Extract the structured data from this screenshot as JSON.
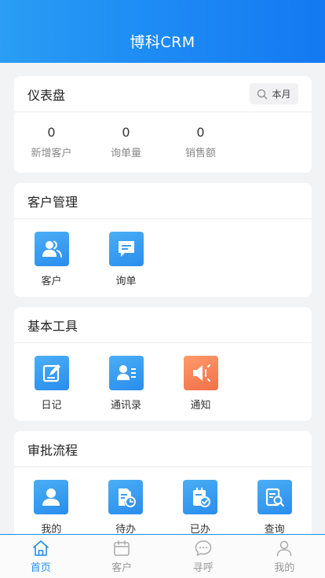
{
  "header": {
    "title": "博科CRM"
  },
  "dashboard": {
    "title": "仪表盘",
    "period_filter": "本月",
    "stats": [
      {
        "value": "0",
        "label": "新增客户"
      },
      {
        "value": "0",
        "label": "询单量"
      },
      {
        "value": "0",
        "label": "销售额"
      }
    ]
  },
  "customer_mgmt": {
    "title": "客户管理",
    "items": [
      {
        "label": "客户",
        "icon": "customers-icon"
      },
      {
        "label": "询单",
        "icon": "inquiry-icon"
      }
    ]
  },
  "basic_tools": {
    "title": "基本工具",
    "items": [
      {
        "label": "日记",
        "icon": "diary-icon"
      },
      {
        "label": "通讯录",
        "icon": "contacts-icon"
      },
      {
        "label": "通知",
        "icon": "notification-icon"
      }
    ]
  },
  "approval": {
    "title": "审批流程",
    "items": [
      {
        "label": "我的",
        "icon": "my-approval-icon"
      },
      {
        "label": "待办",
        "icon": "pending-icon"
      },
      {
        "label": "已办",
        "icon": "done-icon"
      },
      {
        "label": "查询",
        "icon": "query-icon"
      }
    ]
  },
  "tabbar": {
    "items": [
      {
        "label": "首页",
        "icon": "home-icon",
        "active": true
      },
      {
        "label": "客户",
        "icon": "calendar-icon",
        "active": false
      },
      {
        "label": "寻呼",
        "icon": "chat-icon",
        "active": false
      },
      {
        "label": "我的",
        "icon": "user-icon",
        "active": false
      }
    ]
  },
  "colors": {
    "primary": "#1f8ef0",
    "tile_blue": "#3a9ff2",
    "tile_orange": "#f77e55",
    "background": "#f2f3f5"
  }
}
